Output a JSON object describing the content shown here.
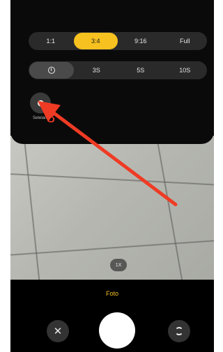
{
  "aspect_ratio": {
    "options": [
      "1:1",
      "3:4",
      "9:16",
      "Full"
    ],
    "selected": "3:4"
  },
  "timer": {
    "icon": "clock-icon",
    "options": [
      "3S",
      "5S",
      "10S"
    ]
  },
  "settings": {
    "icon": "gear-icon",
    "label": "Setelan"
  },
  "zoom": {
    "label": "1X"
  },
  "mode": {
    "label": "Foto"
  },
  "controls": {
    "close_icon": "close-icon",
    "close_glyph": "✕",
    "switch_icon": "switch-camera-icon"
  },
  "annotation": {
    "number": "3",
    "color": "#ef3b24"
  },
  "colors": {
    "accent": "#f7c21f",
    "background": "#000000"
  }
}
